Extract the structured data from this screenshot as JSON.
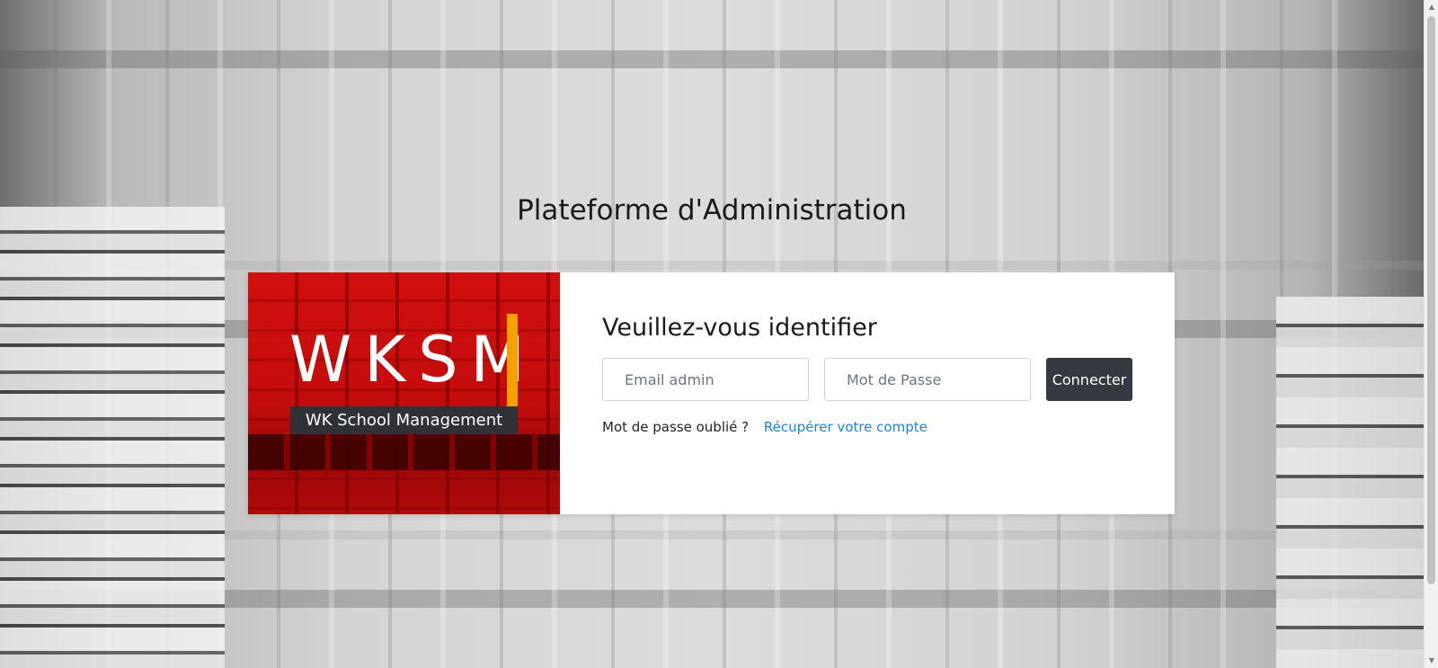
{
  "page": {
    "title": "Plateforme d'Administration"
  },
  "logo": {
    "letters": "WKSM",
    "subtitle": "WK School Management",
    "colors": {
      "background": "#c40c0c",
      "accent": "#f5a200",
      "subtitle_bg": "#2f3338"
    }
  },
  "login": {
    "heading": "Veuillez-vous identifier",
    "email_placeholder": "Email admin",
    "email_value": "",
    "password_placeholder": "Mot de Passe",
    "password_value": "",
    "connect_label": "Connecter",
    "forgot_text": "Mot de passe oublié ?",
    "recover_link": "Récupérer votre compte"
  },
  "scrollbar": {
    "up_icon": "chevron-up-icon",
    "down_icon": "chevron-down-icon"
  },
  "colors": {
    "button_bg": "#343a40",
    "link": "#1a82e8"
  }
}
